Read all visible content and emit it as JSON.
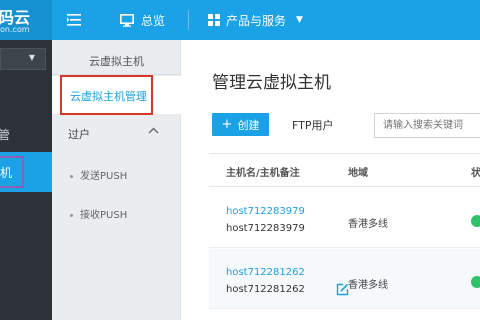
{
  "header": {
    "logo_text": "码云",
    "logo_subtext": "on.com",
    "nav": [
      {
        "label": "总览",
        "icon": "monitor-icon"
      },
      {
        "label": "产品与服务",
        "icon": "grid-icon"
      }
    ]
  },
  "sidebar": {
    "labels": [
      "管",
      "机"
    ]
  },
  "subnav": {
    "title": "云虚拟主机",
    "active_item": "云虚拟主机管理",
    "group": "过户",
    "items": [
      "发送PUSH",
      "接收PUSH"
    ]
  },
  "main": {
    "title": "管理云虚拟主机",
    "create_label": "创建",
    "ftp_label": "FTP用户",
    "search_placeholder": "请输入搜索关键词",
    "columns": [
      "主机名/主机备注",
      "地域",
      "状"
    ],
    "rows": [
      {
        "host": "host712283979",
        "note": "host712283979",
        "region": "香港多线",
        "status_color": "#2ec26b"
      },
      {
        "host": "host712281262",
        "note": "host712281262",
        "region": "香港多线",
        "status_color": "#2ec26b"
      }
    ]
  },
  "colors": {
    "accent": "#1aa1e6",
    "sidebar_bg": "#2c3238",
    "highlight_red": "#d9362a",
    "highlight_purple": "#8a5fb5"
  }
}
